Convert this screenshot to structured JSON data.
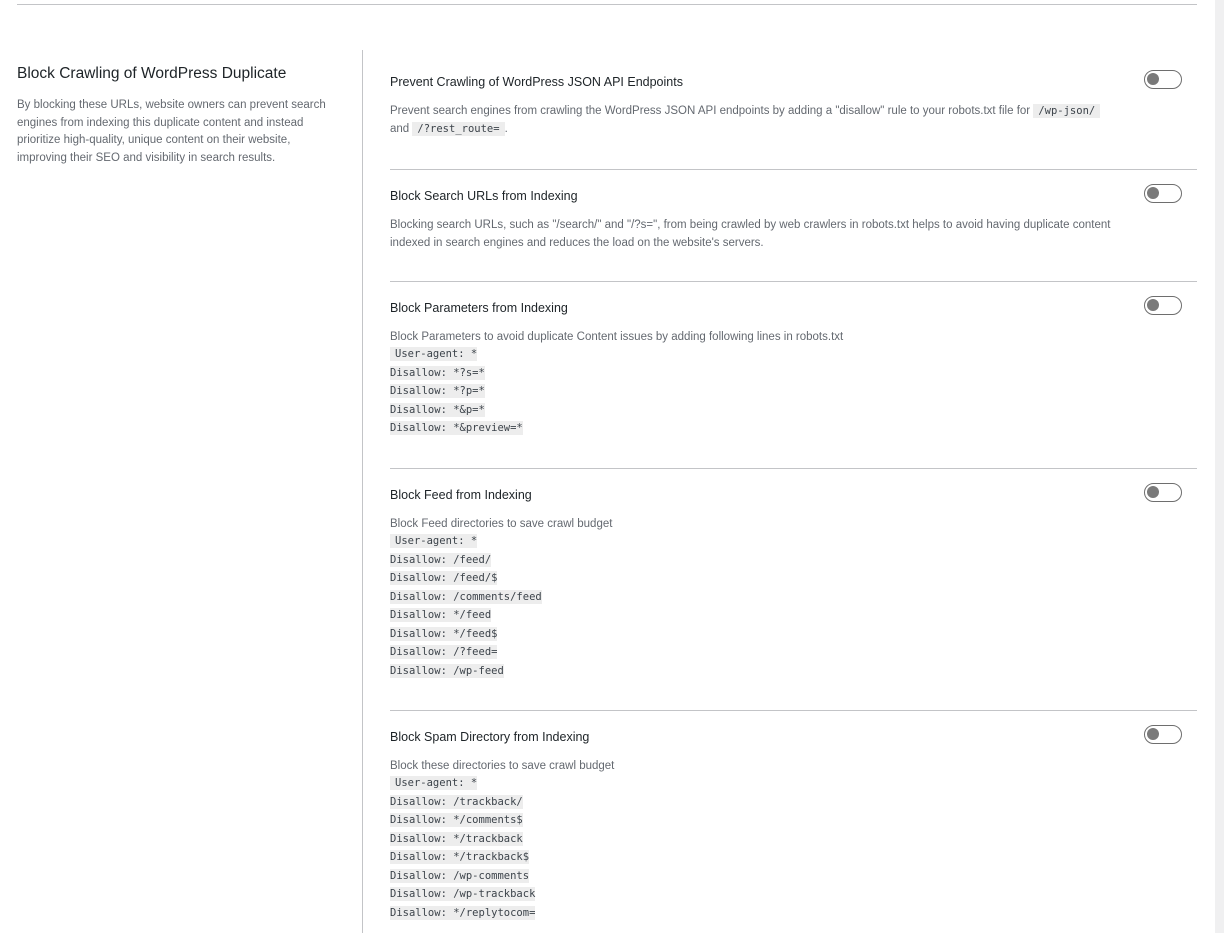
{
  "sidebar": {
    "heading": "Block Crawling of WordPress Duplicate",
    "description": "By blocking these URLs, website owners can prevent search engines from indexing this duplicate content and instead prioritize high-quality, unique content on their website, improving their SEO and visibility in search results."
  },
  "settings": [
    {
      "title": "Prevent Crawling of WordPress JSON API Endpoints",
      "enabled": false,
      "desc_before": "Prevent search engines from crawling the WordPress JSON API endpoints by adding a \"disallow\" rule to your robots.txt file for",
      "code1": "/wp-json/",
      "desc_and": "and",
      "code2": "/?rest_route=",
      "desc_after": "."
    },
    {
      "title": "Block Search URLs from Indexing",
      "enabled": false,
      "description": "Blocking search URLs, such as \"/search/\" and \"/?s=\", from being crawled by web crawlers in robots.txt helps to avoid having duplicate content indexed in search engines and reduces the load on the website's servers."
    },
    {
      "title": "Block Parameters from Indexing",
      "enabled": false,
      "description": "Block Parameters to avoid duplicate Content issues by adding following lines in robots.txt",
      "lines": [
        "User-agent: *",
        "Disallow: *?s=*",
        "Disallow: *?p=*",
        "Disallow: *&p=*",
        "Disallow: *&preview=*"
      ]
    },
    {
      "title": "Block Feed from Indexing",
      "enabled": false,
      "description": "Block Feed directories to save crawl budget",
      "lines": [
        "User-agent: *",
        "Disallow: /feed/",
        "Disallow: /feed/$",
        "Disallow: /comments/feed",
        "Disallow: */feed",
        "Disallow: */feed$",
        "Disallow: /?feed=",
        "Disallow: /wp-feed"
      ]
    },
    {
      "title": "Block Spam Directory from Indexing",
      "enabled": false,
      "description": "Block these directories to save crawl budget",
      "lines": [
        "User-agent: *",
        "Disallow: /trackback/",
        "Disallow: */comments$",
        "Disallow: */trackback",
        "Disallow: */trackback$",
        "Disallow: /wp-comments",
        "Disallow: /wp-trackback",
        "Disallow: */replytocom="
      ]
    }
  ]
}
